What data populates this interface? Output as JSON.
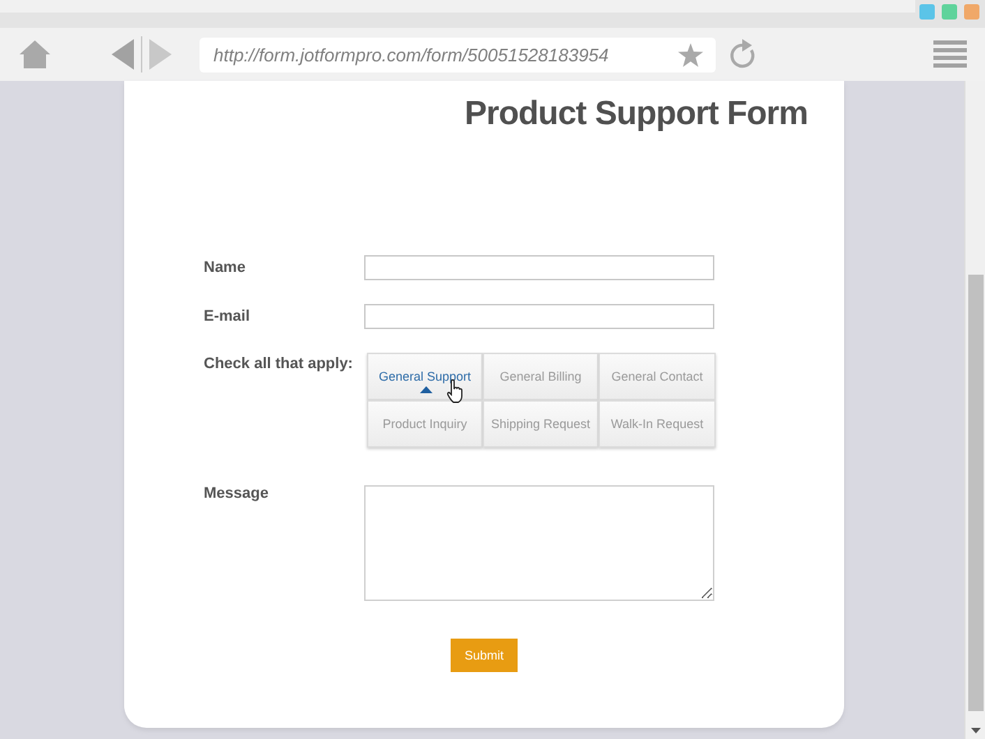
{
  "browser": {
    "url": "http://form.jotformpro.com/form/50051528183954"
  },
  "form": {
    "title": "Product Support Form",
    "fields": [
      {
        "kind": "text",
        "label": "Name"
      },
      {
        "kind": "text",
        "label": "E-mail"
      },
      {
        "kind": "options",
        "label": "Check all that apply:",
        "options": [
          {
            "label": "General Support",
            "selected": true
          },
          {
            "label": "General Billing",
            "selected": false
          },
          {
            "label": "General Contact",
            "selected": false
          },
          {
            "label": "Product Inquiry",
            "selected": false
          },
          {
            "label": "Shipping Request",
            "selected": false
          },
          {
            "label": "Walk-In Request",
            "selected": false
          }
        ]
      },
      {
        "kind": "textarea",
        "label": "Message"
      }
    ],
    "submit": "Submit"
  }
}
